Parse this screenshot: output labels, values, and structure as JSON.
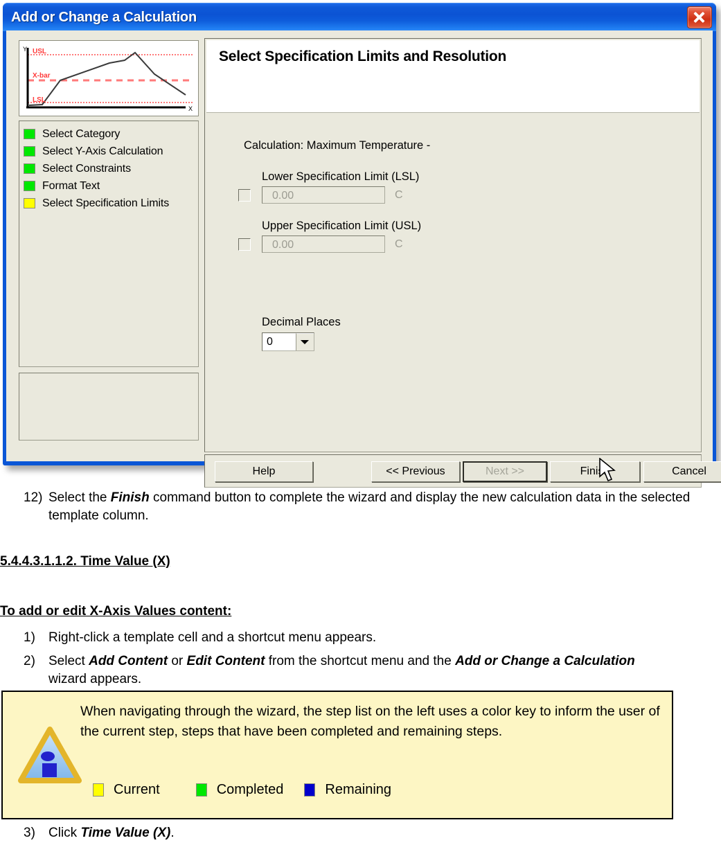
{
  "dialog": {
    "title": "Add or Change a Calculation",
    "close_label": "Close",
    "preview": {
      "y_axis_label": "Y",
      "x_axis_label": "X",
      "usl_label": "USL",
      "xbar_label": "X-bar",
      "lsl_label": "LSL"
    },
    "steps": [
      {
        "label": "Select Category",
        "color": "#00e800",
        "state": "Completed"
      },
      {
        "label": "Select Y-Axis Calculation",
        "color": "#00e800",
        "state": "Completed"
      },
      {
        "label": "Select Constraints",
        "color": "#00e800",
        "state": "Completed"
      },
      {
        "label": "Format Text",
        "color": "#00e800",
        "state": "Completed"
      },
      {
        "label": "Select Specification Limits",
        "color": "#ffff00",
        "state": "Current"
      }
    ],
    "panel": {
      "header_title": "Select Specification Limits and Resolution",
      "calculation_line": "Calculation: Maximum Temperature -",
      "lsl": {
        "label": "Lower Specification Limit (LSL)",
        "value": "0.00",
        "unit": "C",
        "checked": false
      },
      "usl": {
        "label": "Upper Specification Limit (USL)",
        "value": "0.00",
        "unit": "C",
        "checked": false
      },
      "decimal": {
        "label": "Decimal Places",
        "value": "0"
      }
    },
    "buttons": {
      "help": "Help",
      "previous": "<< Previous",
      "next": "Next >>",
      "finish": "Finish",
      "cancel": "Cancel"
    }
  },
  "document": {
    "step12": {
      "number": "12)",
      "part1": "Select the ",
      "bold1": "Finish",
      "part2": " command button to complete the wizard and display the new calculation data in the selected template column."
    },
    "section_heading": "5.4.4.3.1.1.2. Time Value (X)",
    "subheading": "To add or edit X-Axis Values content:",
    "step1": {
      "number": "1)",
      "text": "Right-click a template cell and a shortcut menu appears."
    },
    "step2": {
      "number": "2)",
      "part1": "Select ",
      "bold1": "Add Content",
      "part2": " or ",
      "bold2": "Edit Content",
      "part3": " from the shortcut menu and the ",
      "bold3": "Add or Change a Calculation",
      "part4": " wizard appears."
    },
    "step3": {
      "number": "3)",
      "part1": "Click ",
      "bold1": "Time Value (X)",
      "part2": "."
    },
    "note": {
      "body": "When navigating through the wizard, the step list on the left uses a color key to inform the user of the current step, steps that have been completed and remaining steps.",
      "key": [
        {
          "label": "Current",
          "color": "#ffff00"
        },
        {
          "label": "Completed",
          "color": "#00e800"
        },
        {
          "label": "Remaining",
          "color": "#0000cc"
        }
      ]
    }
  },
  "colors": {
    "titlebar_blue": "#0b53d4",
    "dialog_face": "#eae9dd",
    "note_background": "#fdf6c4",
    "spec_line_red": "#ff6b6b"
  }
}
